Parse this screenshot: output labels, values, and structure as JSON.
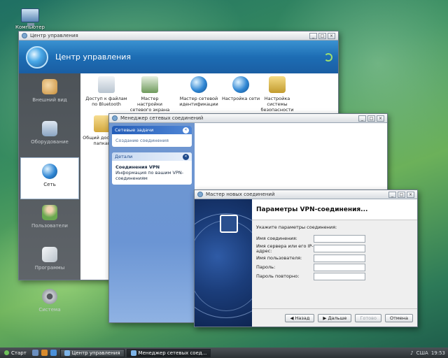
{
  "desktop": {
    "icon_label": "Компьютер"
  },
  "control_center": {
    "title": "Центр управления",
    "banner_title": "Центр управления",
    "sidebar": [
      {
        "label": "Внешний вид",
        "icon": "palette-icon",
        "color": "#c98f3a"
      },
      {
        "label": "Оборудование",
        "icon": "hardware-icon",
        "color": "#8aa4c2"
      },
      {
        "label": "Сеть",
        "icon": "globe-icon",
        "color": "#2f86d3"
      },
      {
        "label": "Пользователи",
        "icon": "users-icon",
        "color": "#6aa84f"
      },
      {
        "label": "Программы",
        "icon": "software-icon",
        "color": "#b9c2ca"
      },
      {
        "label": "Система",
        "icon": "gears-icon",
        "color": "#c9ccd0"
      }
    ],
    "items": [
      {
        "label": "Доступ к файлам по Bluetooth",
        "icon": "bluetooth-icon"
      },
      {
        "label": "Мастер настройки сетевого экрана",
        "icon": "firewall-icon"
      },
      {
        "label": "Мастер сетевой идентификации",
        "icon": "network-id-icon"
      },
      {
        "label": "Настройка сети",
        "icon": "network-settings-icon"
      },
      {
        "label": "Настройка системы безопасности",
        "icon": "lock-icon"
      },
      {
        "label": "Общий доступ к папкам",
        "icon": "shared-folder-icon"
      }
    ]
  },
  "network_manager": {
    "title": "Менеджер сетевых соединений",
    "tasks_header": "Сетевые задачи",
    "tasks_link": "Создание соединения",
    "details_header": "Детали",
    "details_title": "Соединения VPN",
    "details_text": "Информация по вашим VPN-соединениям"
  },
  "wizard": {
    "title": "Мастер новых соединений",
    "header": "Параметры VPN-соединения...",
    "intro": "Укажите параметры соединения:",
    "fields": [
      {
        "label": "Имя соединения:",
        "value": ""
      },
      {
        "label": "Имя сервера или его IP-адрес:",
        "value": ""
      },
      {
        "label": "Имя пользователя:",
        "value": ""
      },
      {
        "label": "Пароль:",
        "value": ""
      },
      {
        "label": "Пароль повторно:",
        "value": ""
      }
    ],
    "buttons": {
      "back": "Назад",
      "next": "Дальше",
      "done": "Готово",
      "cancel": "Отмена"
    }
  },
  "taskbar": {
    "start": "Старт",
    "tasks": [
      "Центр управления",
      "Менеджер сетевых соед..."
    ],
    "tray_lang": "США",
    "clock": "19:53"
  }
}
